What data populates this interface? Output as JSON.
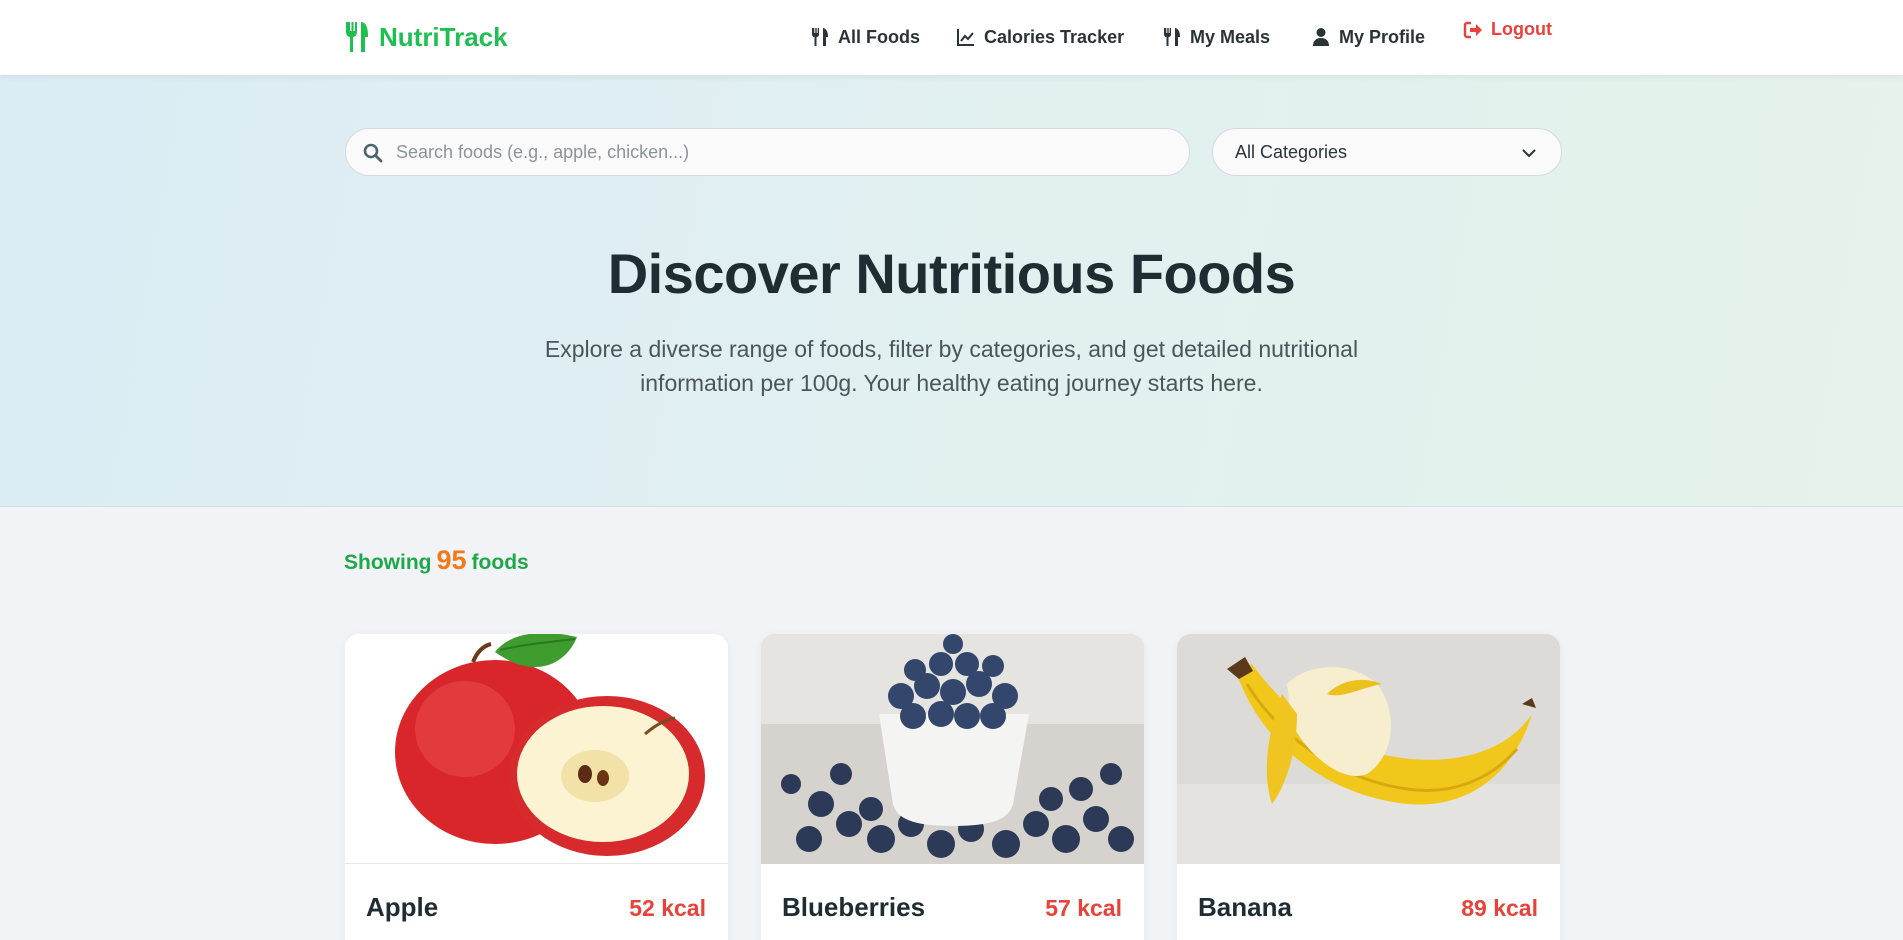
{
  "header": {
    "brand": "NutriTrack",
    "nav": [
      {
        "label": "All Foods",
        "icon": "utensils-icon"
      },
      {
        "label": "Calories Tracker",
        "icon": "line-chart-icon"
      },
      {
        "label": "My Meals",
        "icon": "utensils-icon"
      },
      {
        "label": "My Profile",
        "icon": "user-icon"
      },
      {
        "label": "Logout",
        "icon": "sign-out-icon"
      }
    ]
  },
  "search": {
    "placeholder": "Search foods (e.g., apple, chicken...)",
    "value": "",
    "category_selected": "All Categories"
  },
  "hero": {
    "title": "Discover Nutritious Foods",
    "subtitle": "Explore a diverse range of foods, filter by categories, and get detailed nutritional information per 100g. Your healthy eating journey starts here."
  },
  "results": {
    "prefix": "Showing",
    "count": "95",
    "suffix": "foods"
  },
  "foods": [
    {
      "name": "Apple",
      "kcal": "52 kcal"
    },
    {
      "name": "Blueberries",
      "kcal": "57 kcal"
    },
    {
      "name": "Banana",
      "kcal": "89 kcal"
    }
  ],
  "colors": {
    "brand": "#1fbf52",
    "logout": "#e8423b",
    "kcal": "#e8423b",
    "count": "#f07a1c"
  }
}
